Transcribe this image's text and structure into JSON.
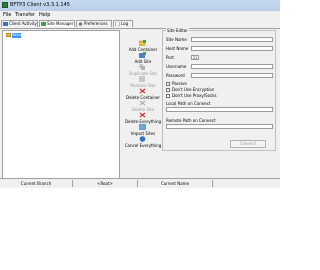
{
  "window": {
    "title": "BFTP3 Client v3.3.1.145"
  },
  "menu": [
    "File",
    "Transfer",
    "Help"
  ],
  "tabs": {
    "client_activity": "Client Activity",
    "site_manager": "Site Manager",
    "preferences": "Preferences",
    "log": "Log"
  },
  "tree": {
    "root_label": "Sites"
  },
  "toolbar": {
    "add_container": "Add Container",
    "add_site": "Add Site",
    "duplicate_site": "Duplicate Site",
    "remove_site": "Remove Site",
    "delete_container": "Delete Container",
    "delete_site": "Delete Site",
    "delete_everything": "Delete Everything",
    "import_sites": "Import Sites",
    "cancel_everything": "Cancel Everything"
  },
  "site_editor": {
    "title": "Site Editor",
    "site_name_label": "Site Name",
    "host_name_label": "Host Name",
    "port_label": "Port",
    "port_value": "21",
    "username_label": "Username",
    "password_label": "Password",
    "passive_label": "Passive",
    "no_encryption_label": "Don't Use Encryption",
    "no_proxy_label": "Don't Use Proxy/Socks",
    "local_path_label": "Local Path on Connect",
    "remote_path_label": "Remote Path on Connect",
    "connect_label": "Connect"
  },
  "status": {
    "current_branch_label": "Current Branch",
    "current_branch_value": "<Root>",
    "current_name_label": "Current Name",
    "current_name_value": ""
  }
}
